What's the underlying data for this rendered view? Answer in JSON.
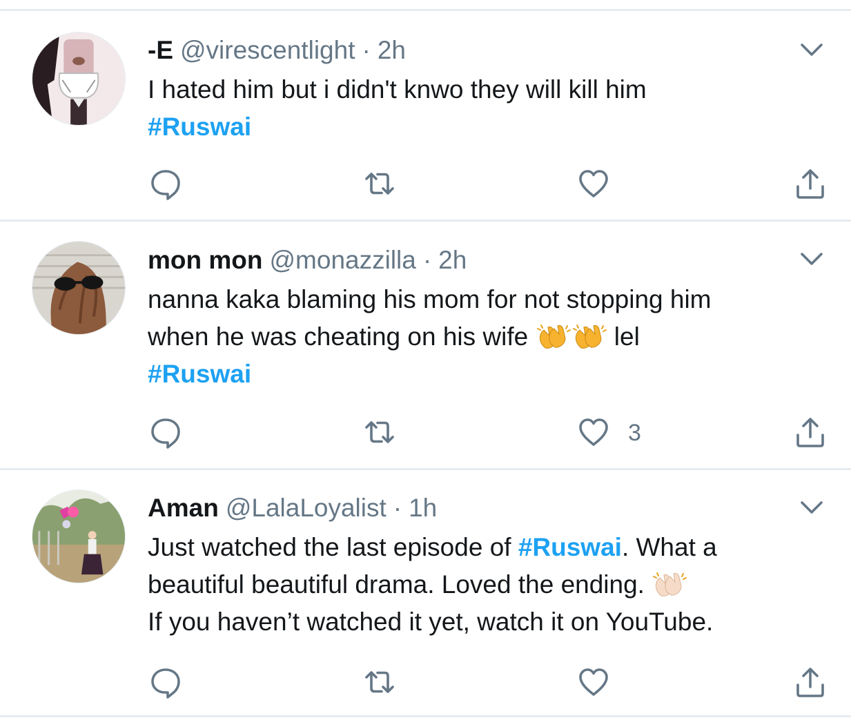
{
  "tweets": [
    {
      "name": "-E",
      "handle": "@virescentlight",
      "dot": "·",
      "time": "2h",
      "text_1": "I hated him but i didn't knwo they will kill him",
      "hashtag": "#Ruswai",
      "like_count": "",
      "avatar_icon": "avatar-anime-girl"
    },
    {
      "name": "mon mon",
      "handle": "@monazzilla",
      "dot": "·",
      "time": "2h",
      "text_1": "nanna kaka blaming his mom for not stopping him",
      "text_2": "when he was cheating on his wife",
      "text_3": "lel",
      "hashtag": "#Ruswai",
      "like_count": "3",
      "emoji": "clapping-hands-emoji",
      "avatar_icon": "avatar-hair-sunglasses"
    },
    {
      "name": "Aman",
      "handle": "@LalaLoyalist",
      "dot": "·",
      "time": "1h",
      "text_1": "Just watched the last episode of",
      "hashtag": "#Ruswai",
      "text_2": ". What a",
      "text_3": "beautiful beautiful drama. Loved the ending.",
      "text_4": "If you haven’t watched it yet, watch it on YouTube.",
      "like_count": "",
      "emoji": "clapping-hands-light-skin-emoji",
      "avatar_icon": "avatar-girl-balloons"
    }
  ],
  "colors": {
    "link": "#1da1f2",
    "text": "#14171a",
    "secondary": "#657786",
    "divider": "#e6ecf0"
  },
  "icons": [
    "reply-icon",
    "retweet-icon",
    "like-icon",
    "share-icon",
    "chevron-down-icon"
  ]
}
